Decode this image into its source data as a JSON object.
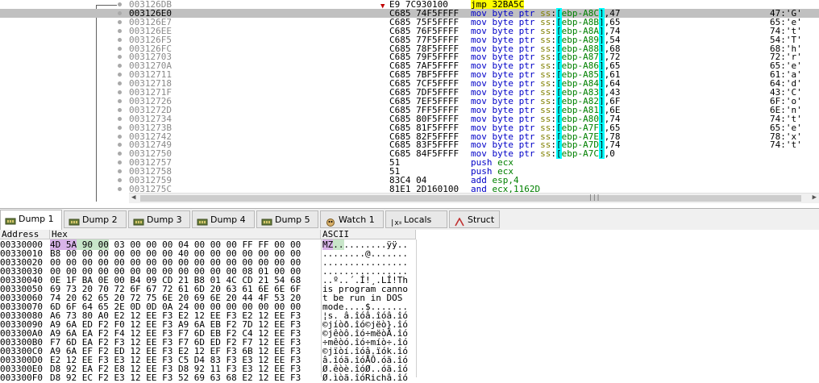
{
  "disasm": {
    "rows": [
      {
        "address": "003126DB",
        "bytes": "E9 7C930100",
        "instr": [
          [
            "jmp",
            "mn jmp"
          ],
          [
            " 32BA5C",
            "jmp"
          ]
        ],
        "comment": "",
        "selected": false
      },
      {
        "address": "003126E0",
        "bytes": "C685 74F5FFFF",
        "instr": "ebp-A8C|47",
        "comment": "47:'G'",
        "selected": true
      },
      {
        "address": "003126E7",
        "bytes": "C685 75F5FFFF",
        "instr": "ebp-A8B|65",
        "comment": "65:'e'",
        "selected": false
      },
      {
        "address": "003126EE",
        "bytes": "C685 76F5FFFF",
        "instr": "ebp-A8A|74",
        "comment": "74:'t'",
        "selected": false
      },
      {
        "address": "003126F5",
        "bytes": "C685 77F5FFFF",
        "instr": "ebp-A89|54",
        "comment": "54:'T'",
        "selected": false
      },
      {
        "address": "003126FC",
        "bytes": "C685 78F5FFFF",
        "instr": "ebp-A88|68",
        "comment": "68:'h'",
        "selected": false
      },
      {
        "address": "00312703",
        "bytes": "C685 79F5FFFF",
        "instr": "ebp-A87|72",
        "comment": "72:'r'",
        "selected": false
      },
      {
        "address": "0031270A",
        "bytes": "C685 7AF5FFFF",
        "instr": "ebp-A86|65",
        "comment": "65:'e'",
        "selected": false
      },
      {
        "address": "00312711",
        "bytes": "C685 7BF5FFFF",
        "instr": "ebp-A85|61",
        "comment": "61:'a'",
        "selected": false
      },
      {
        "address": "00312718",
        "bytes": "C685 7CF5FFFF",
        "instr": "ebp-A84|64",
        "comment": "64:'d'",
        "selected": false
      },
      {
        "address": "0031271F",
        "bytes": "C685 7DF5FFFF",
        "instr": "ebp-A83|43",
        "comment": "43:'C'",
        "selected": false
      },
      {
        "address": "00312726",
        "bytes": "C685 7EF5FFFF",
        "instr": "ebp-A82|6F",
        "comment": "6F:'o'",
        "selected": false
      },
      {
        "address": "0031272D",
        "bytes": "C685 7FF5FFFF",
        "instr": "ebp-A81|6E",
        "comment": "6E:'n'",
        "selected": false
      },
      {
        "address": "00312734",
        "bytes": "C685 80F5FFFF",
        "instr": "ebp-A80|74",
        "comment": "74:'t'",
        "selected": false
      },
      {
        "address": "0031273B",
        "bytes": "C685 81F5FFFF",
        "instr": "ebp-A7F|65",
        "comment": "65:'e'",
        "selected": false
      },
      {
        "address": "00312742",
        "bytes": "C685 82F5FFFF",
        "instr": "ebp-A7E|78",
        "comment": "78:'x'",
        "selected": false
      },
      {
        "address": "00312749",
        "bytes": "C685 83F5FFFF",
        "instr": "ebp-A7D|74",
        "comment": "74:'t'",
        "selected": false
      },
      {
        "address": "00312750",
        "bytes": "C685 84F5FFFF",
        "instr": "ebp-A7C|0",
        "comment": "",
        "selected": false
      },
      {
        "address": "00312757",
        "bytes": "51",
        "instr": "push ecx",
        "comment": "",
        "selected": false
      },
      {
        "address": "00312758",
        "bytes": "51",
        "instr": "push ecx",
        "comment": "",
        "selected": false
      },
      {
        "address": "00312759",
        "bytes": "83C4 04",
        "instr": "add esp,4",
        "comment": "",
        "selected": false
      },
      {
        "address": "0031275C",
        "bytes": "81E1 2D160100",
        "instr": "and ecx,1162D",
        "comment": "",
        "selected": false
      }
    ]
  },
  "tabs": [
    {
      "label": "Dump 1",
      "icon": "memory-icon",
      "active": true
    },
    {
      "label": "Dump 2",
      "icon": "memory-icon",
      "active": false
    },
    {
      "label": "Dump 3",
      "icon": "memory-icon",
      "active": false
    },
    {
      "label": "Dump 4",
      "icon": "memory-icon",
      "active": false
    },
    {
      "label": "Dump 5",
      "icon": "memory-icon",
      "active": false
    },
    {
      "label": "Watch 1",
      "icon": "watch-icon",
      "active": false
    },
    {
      "label": "Locals",
      "icon": "locals-icon",
      "active": false
    },
    {
      "label": "Struct",
      "icon": "struct-icon",
      "active": false
    }
  ],
  "dump": {
    "headers": {
      "address": "Address",
      "hex": "Hex",
      "ascii": "ASCII"
    },
    "rows": [
      {
        "address": "00330000",
        "hex": "4D 5A 90 00 03 00 00 00 04 00 00 00 FF FF 00 00",
        "ascii": "MZ..........ÿÿ.."
      },
      {
        "address": "00330010",
        "hex": "B8 00 00 00 00 00 00 00 40 00 00 00 00 00 00 00",
        "ascii": "........@......."
      },
      {
        "address": "00330020",
        "hex": "00 00 00 00 00 00 00 00 00 00 00 00 00 00 00 00",
        "ascii": "................"
      },
      {
        "address": "00330030",
        "hex": "00 00 00 00 00 00 00 00 00 00 00 00 08 01 00 00",
        "ascii": "................"
      },
      {
        "address": "00330040",
        "hex": "0E 1F BA 0E 00 B4 09 CD 21 B8 01 4C CD 21 54 68",
        "ascii": "..º..´.Í!¸.LÍ!Th"
      },
      {
        "address": "00330050",
        "hex": "69 73 20 70 72 6F 67 72 61 6D 20 63 61 6E 6E 6F",
        "ascii": "is program canno"
      },
      {
        "address": "00330060",
        "hex": "74 20 62 65 20 72 75 6E 20 69 6E 20 44 4F 53 20",
        "ascii": "t be run in DOS "
      },
      {
        "address": "00330070",
        "hex": "6D 6F 64 65 2E 0D 0D 0A 24 00 00 00 00 00 00 00",
        "ascii": "mode....$......."
      },
      {
        "address": "00330080",
        "hex": "A6 73 80 A0 E2 12 EE F3 E2 12 EE F3 E2 12 EE F3",
        "ascii": "¦s. â.îóâ.îóâ.îó"
      },
      {
        "address": "00330090",
        "hex": "A9 6A ED F2 F0 12 EE F3 A9 6A EB F2 7D 12 EE F3",
        "ascii": "©jíòð.îó©jëò}.îó"
      },
      {
        "address": "003300A0",
        "hex": "A9 6A EA F2 F4 12 EE F3 F7 6D EB F2 C4 12 EE F3",
        "ascii": "©jêòô.îó÷mëòÄ.îó"
      },
      {
        "address": "003300B0",
        "hex": "F7 6D EA F2 F3 12 EE F3 F7 6D ED F2 F7 12 EE F3",
        "ascii": "÷mêòó.îó÷míò÷.îó"
      },
      {
        "address": "003300C0",
        "hex": "A9 6A EF F2 ED 12 EE F3 E2 12 EF F3 6B 12 EE F3",
        "ascii": "©jïòí.îóâ.ïók.îó"
      },
      {
        "address": "003300D0",
        "hex": "E2 12 EE F3 E3 12 EE F3 C5 D4 83 F3 E3 12 EE F3",
        "ascii": "â.îóã.îóÅÔ.óã.îó"
      },
      {
        "address": "003300E0",
        "hex": "D8 92 EA F2 E8 12 EE F3 D8 92 11 F3 E3 12 EE F3",
        "ascii": "Ø.êòè.îóØ..óã.îó"
      },
      {
        "address": "003300F0",
        "hex": "D8 92 EC F2 E3 12 EE F3 52 69 63 68 E2 12 EE F3",
        "ascii": "Ø.ìòã.îóRichâ.îó"
      }
    ]
  },
  "colors": {
    "mnemonic": "#0000c8",
    "register": "#008000",
    "segment": "#808000",
    "bracket": "#00ffff",
    "jump": "#ffff00",
    "selection": "#c0c0c0"
  }
}
